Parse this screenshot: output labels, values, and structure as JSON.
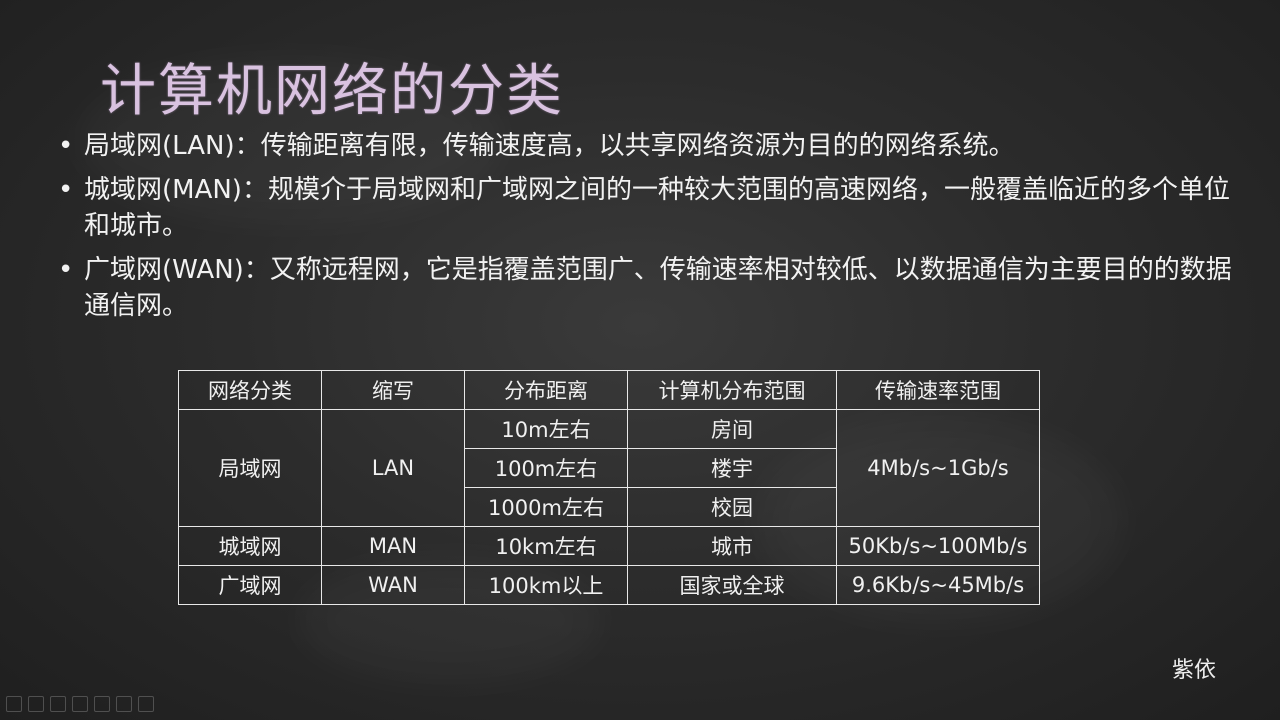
{
  "slide": {
    "title": "计算机网络的分类",
    "bullets": [
      {
        "text": "局域网(LAN)：传输距离有限，传输速度高，以共享网络资源为目的的网络系统。"
      },
      {
        "text": "城域网(MAN)：规模介于局域网和广域网之间的一种较大范围的高速网络，一般覆盖临近的多个单位和城市。"
      },
      {
        "text": "广域网(WAN)：又称远程网，它是指覆盖范围广、传输速率相对较低、以数据通信为主要目的的数据通信网。"
      }
    ],
    "bullet_glyph": "•",
    "author": "紫依"
  },
  "table": {
    "headers": [
      "网络分类",
      "缩写",
      "分布距离",
      "计算机分布范围",
      "传输速率范围"
    ],
    "lan": {
      "category": "局域网",
      "abbr": "LAN",
      "rate": "4Mb/s~1Gb/s",
      "rows": [
        {
          "distance": "10m左右",
          "range": "房间"
        },
        {
          "distance": "100m左右",
          "range": "楼宇"
        },
        {
          "distance": "1000m左右",
          "range": "校园"
        }
      ]
    },
    "man": {
      "category": "城域网",
      "abbr": "MAN",
      "distance": "10km左右",
      "range": "城市",
      "rate": "50Kb/s~100Mb/s"
    },
    "wan": {
      "category": "广域网",
      "abbr": "WAN",
      "distance": "100km以上",
      "range": "国家或全球",
      "rate": "9.6Kb/s~45Mb/s"
    }
  },
  "toolbar": {
    "icons": [
      "pen-icon",
      "slides-icon",
      "eraser-icon",
      "highlighter-icon",
      "pointer-icon",
      "camera-icon",
      "menu-icon"
    ]
  }
}
